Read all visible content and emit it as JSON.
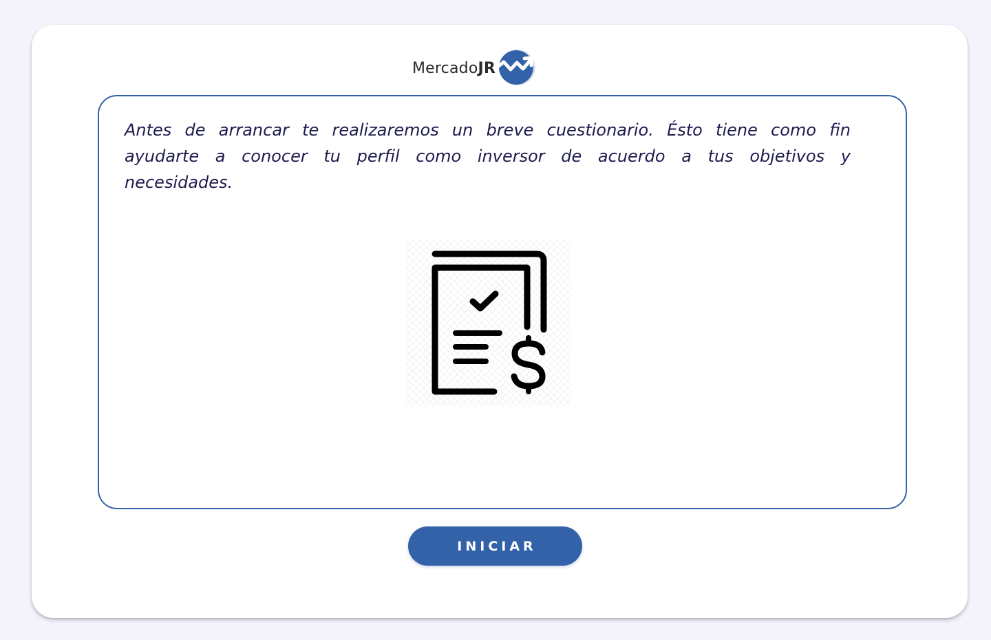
{
  "brand": {
    "name_regular": "Mercado",
    "name_bold": "JR",
    "mark_icon": "trend-up-arrow-circle-icon",
    "mark_color": "#3362a9"
  },
  "intro": {
    "text": "Antes de arrancar te realizaremos un breve cuestionario. Ésto tiene como fin ayudarte a conocer tu perfil como inversor de acuerdo a tus objetivos y necesidades."
  },
  "illustration": {
    "icon": "financial-document-checklist-icon"
  },
  "actions": {
    "start_label": "INICIAR"
  },
  "colors": {
    "accent": "#3362a9",
    "text": "#1d1b4d",
    "background": "#f4f3fc",
    "card": "#ffffff"
  }
}
